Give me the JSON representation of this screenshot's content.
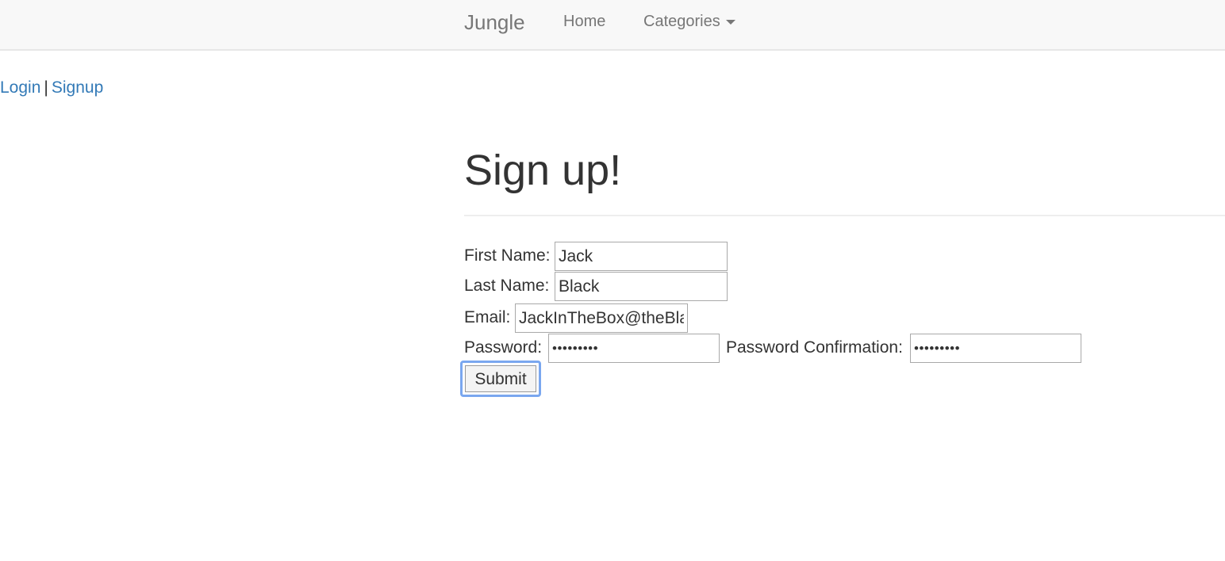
{
  "navbar": {
    "brand": "Jungle",
    "home": "Home",
    "categories": "Categories"
  },
  "auth": {
    "login": "Login",
    "separator": "|",
    "signup": "Signup"
  },
  "page": {
    "title": "Sign up!"
  },
  "form": {
    "first_name_label": "First Name:",
    "first_name_value": "Jack",
    "last_name_label": "Last Name:",
    "last_name_value": "Black",
    "email_label": "Email:",
    "email_value": "JackInTheBox@theBla",
    "password_label": "Password:",
    "password_value": "•••••••••",
    "password_confirmation_label": "Password Confirmation:",
    "password_confirmation_value": "•••••••••",
    "submit_label": "Submit"
  }
}
